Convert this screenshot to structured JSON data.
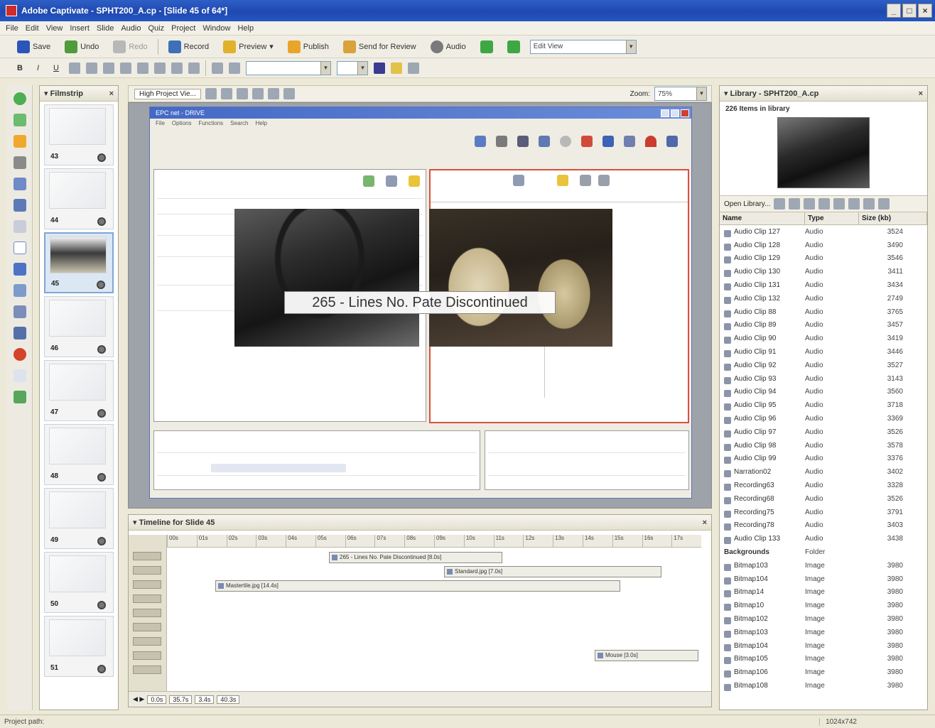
{
  "window": {
    "title": "Adobe Captivate - SPHT200_A.cp - [Slide 45 of 64*]"
  },
  "menu": [
    "File",
    "Edit",
    "View",
    "Insert",
    "Slide",
    "Audio",
    "Quiz",
    "Project",
    "Window",
    "Help"
  ],
  "toolbar": {
    "save": "Save",
    "undo": "Undo",
    "redo": "Redo",
    "record": "Record",
    "preview": "Preview",
    "publish": "Publish",
    "send_for_review": "Send for Review",
    "audio": "Audio",
    "view_combo": "Edit View"
  },
  "filmstrip": {
    "title": "Filmstrip",
    "slides": [
      "43",
      "44",
      "45",
      "46",
      "47",
      "48",
      "49",
      "50",
      "51"
    ],
    "selected": "45"
  },
  "stage": {
    "tab": "High Project Vie...",
    "zoom_label": "Zoom:",
    "zoom_value": "75%",
    "inner_title": "EPC net - DRIVE",
    "inner_menu": [
      "File",
      "Options",
      "Functions",
      "Search",
      "Help"
    ],
    "caption": "265 - Lines No. Pate Discontinued"
  },
  "timeline": {
    "title": "Timeline for Slide 45",
    "ticks": [
      "00s",
      "01s",
      "02s",
      "03s",
      "04s",
      "05s",
      "06s",
      "07s",
      "08s",
      "09s",
      "10s",
      "11s",
      "12s",
      "13s",
      "14s",
      "15s",
      "16s",
      "17s"
    ],
    "bars": [
      "265 - Lines No. Pate Discontinued [8.0s]",
      "Standard.jpg [7.0s]",
      "Mastertile.jpg [14.4s]",
      "Mouse [3.0s]"
    ],
    "footer": [
      "0.0s",
      "35.7s",
      "3.4s",
      "40.3s"
    ]
  },
  "library": {
    "title": "Library - SPHT200_A.cp",
    "count": "226 Items in library",
    "open_library": "Open Library...",
    "columns": [
      "Name",
      "Type",
      "Size (kb)"
    ],
    "items": [
      {
        "name": "Audio Clip 127",
        "type": "Audio",
        "size": "3524"
      },
      {
        "name": "Audio Clip 128",
        "type": "Audio",
        "size": "3490"
      },
      {
        "name": "Audio Clip 129",
        "type": "Audio",
        "size": "3546"
      },
      {
        "name": "Audio Clip 130",
        "type": "Audio",
        "size": "3411"
      },
      {
        "name": "Audio Clip 131",
        "type": "Audio",
        "size": "3434"
      },
      {
        "name": "Audio Clip 132",
        "type": "Audio",
        "size": "2749"
      },
      {
        "name": "Audio Clip 88",
        "type": "Audio",
        "size": "3765"
      },
      {
        "name": "Audio Clip 89",
        "type": "Audio",
        "size": "3457"
      },
      {
        "name": "Audio Clip 90",
        "type": "Audio",
        "size": "3419"
      },
      {
        "name": "Audio Clip 91",
        "type": "Audio",
        "size": "3446"
      },
      {
        "name": "Audio Clip 92",
        "type": "Audio",
        "size": "3527"
      },
      {
        "name": "Audio Clip 93",
        "type": "Audio",
        "size": "3143"
      },
      {
        "name": "Audio Clip 94",
        "type": "Audio",
        "size": "3560"
      },
      {
        "name": "Audio Clip 95",
        "type": "Audio",
        "size": "3718"
      },
      {
        "name": "Audio Clip 96",
        "type": "Audio",
        "size": "3369"
      },
      {
        "name": "Audio Clip 97",
        "type": "Audio",
        "size": "3526"
      },
      {
        "name": "Audio Clip 98",
        "type": "Audio",
        "size": "3578"
      },
      {
        "name": "Audio Clip 99",
        "type": "Audio",
        "size": "3376"
      },
      {
        "name": "Narration02",
        "type": "Audio",
        "size": "3402"
      },
      {
        "name": "Recording63",
        "type": "Audio",
        "size": "3328"
      },
      {
        "name": "Recording68",
        "type": "Audio",
        "size": "3526"
      },
      {
        "name": "Recording75",
        "type": "Audio",
        "size": "3791"
      },
      {
        "name": "Recording78",
        "type": "Audio",
        "size": "3403"
      },
      {
        "name": "Audio Clip 133",
        "type": "Audio",
        "size": "3438"
      },
      {
        "name": "Backgrounds",
        "type": "Folder",
        "size": "",
        "folder": true
      },
      {
        "name": "Bitmap103",
        "type": "Image",
        "size": "3980"
      },
      {
        "name": "Bitmap104",
        "type": "Image",
        "size": "3980"
      },
      {
        "name": "Bitmap14",
        "type": "Image",
        "size": "3980"
      },
      {
        "name": "Bitmap10",
        "type": "Image",
        "size": "3980"
      },
      {
        "name": "Bitmap102",
        "type": "Image",
        "size": "3980"
      },
      {
        "name": "Bitmap103",
        "type": "Image",
        "size": "3980"
      },
      {
        "name": "Bitmap104",
        "type": "Image",
        "size": "3980"
      },
      {
        "name": "Bitmap105",
        "type": "Image",
        "size": "3980"
      },
      {
        "name": "Bitmap106",
        "type": "Image",
        "size": "3980"
      },
      {
        "name": "Bitmap108",
        "type": "Image",
        "size": "3980"
      }
    ]
  },
  "status": {
    "left": "Project path:",
    "right": "1024x742"
  },
  "colors": {
    "title_bar": "#1E49B0",
    "chrome": "#ECE9D8",
    "selection_border": "#D9503B"
  }
}
